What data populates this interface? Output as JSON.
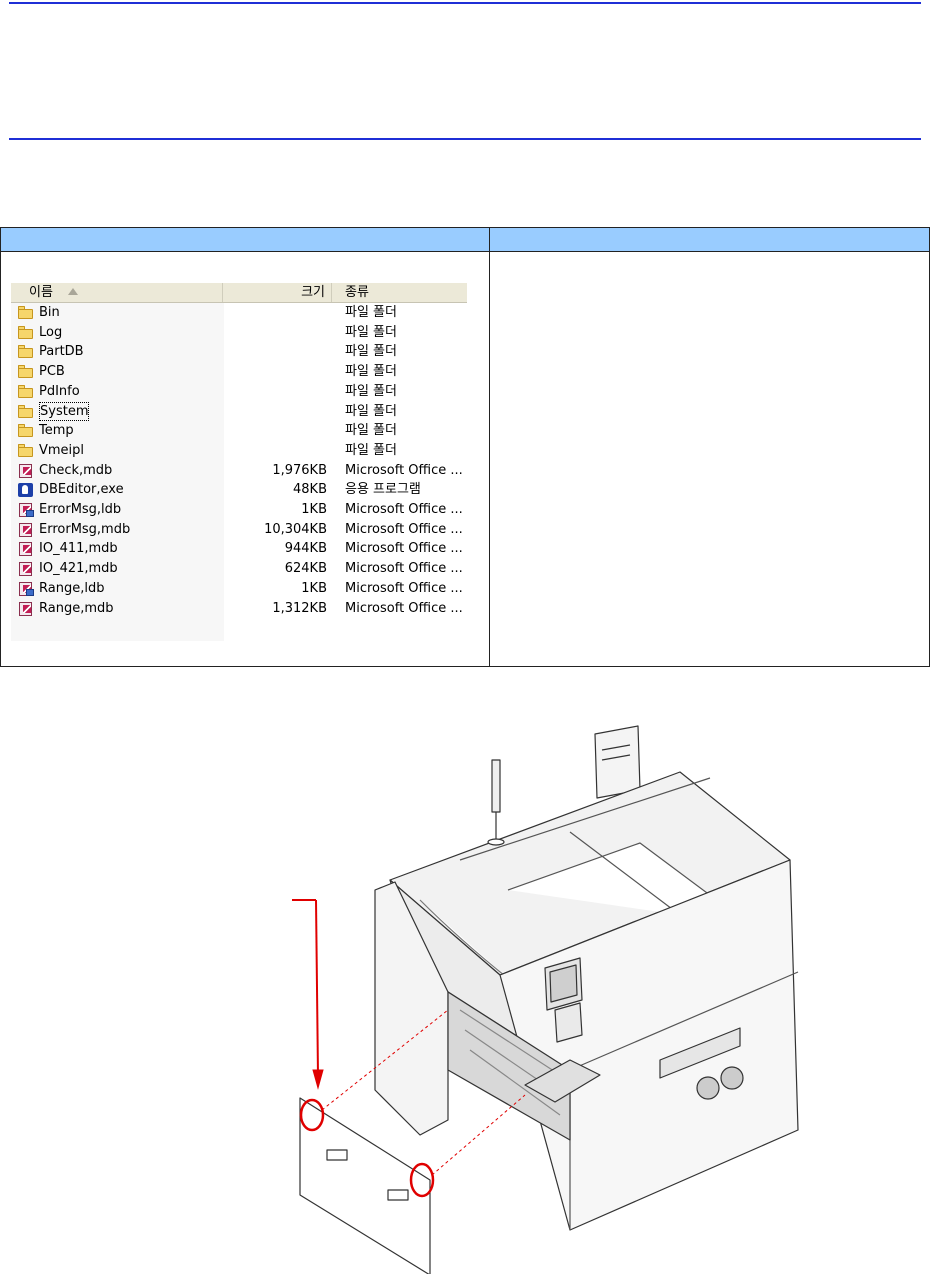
{
  "explorer": {
    "columns": {
      "name": "이름",
      "size": "크기",
      "type": "종류"
    },
    "rows": [
      {
        "icon": "folder-icon",
        "name": "Bin",
        "size": "",
        "type": "파일 폴더"
      },
      {
        "icon": "folder-icon",
        "name": "Log",
        "size": "",
        "type": "파일 폴더"
      },
      {
        "icon": "folder-icon",
        "name": "PartDB",
        "size": "",
        "type": "파일 폴더"
      },
      {
        "icon": "folder-icon",
        "name": "PCB",
        "size": "",
        "type": "파일 폴더"
      },
      {
        "icon": "folder-icon",
        "name": "PdInfo",
        "size": "",
        "type": "파일 폴더"
      },
      {
        "icon": "folder-icon",
        "name": "System",
        "size": "",
        "type": "파일 폴더"
      },
      {
        "icon": "folder-icon",
        "name": "Temp",
        "size": "",
        "type": "파일 폴더"
      },
      {
        "icon": "folder-icon",
        "name": "Vmeipl",
        "size": "",
        "type": "파일 폴더"
      },
      {
        "icon": "access-database-icon",
        "name": "Check,mdb",
        "size": "1,976KB",
        "type": "Microsoft Office ..."
      },
      {
        "icon": "application-exe-icon",
        "name": "DBEditor,exe",
        "size": "48KB",
        "type": "응용 프로그램"
      },
      {
        "icon": "access-lock-file-icon",
        "name": "ErrorMsg,ldb",
        "size": "1KB",
        "type": "Microsoft Office ..."
      },
      {
        "icon": "access-database-icon",
        "name": "ErrorMsg,mdb",
        "size": "10,304KB",
        "type": "Microsoft Office ..."
      },
      {
        "icon": "access-database-icon",
        "name": "IO_411,mdb",
        "size": "944KB",
        "type": "Microsoft Office ..."
      },
      {
        "icon": "access-database-icon",
        "name": "IO_421,mdb",
        "size": "624KB",
        "type": "Microsoft Office ..."
      },
      {
        "icon": "access-lock-file-icon",
        "name": "Range,ldb",
        "size": "1KB",
        "type": "Microsoft Office ..."
      },
      {
        "icon": "access-database-icon",
        "name": "Range,mdb",
        "size": "1,312KB",
        "type": "Microsoft Office ..."
      }
    ]
  },
  "colors": {
    "rule": "#1f2fd6",
    "table_header": "#99ccff",
    "callout_red": "#e00000"
  },
  "figure": {
    "icon": "placement-machine-illustration"
  }
}
